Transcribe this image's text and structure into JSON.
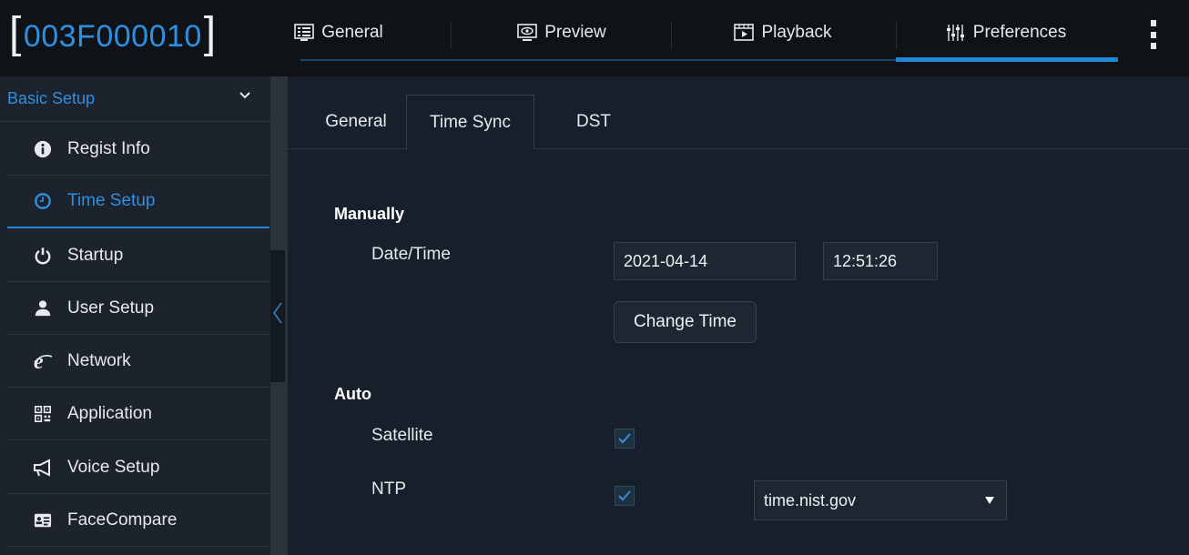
{
  "app": {
    "device_id": "003F000010",
    "accent": "#1e88d8"
  },
  "nav": {
    "tabs": [
      {
        "label": "General",
        "icon": "monitor-list-icon"
      },
      {
        "label": "Preview",
        "icon": "eye-monitor-icon"
      },
      {
        "label": "Playback",
        "icon": "playback-film-icon"
      },
      {
        "label": "Preferences",
        "icon": "sliders-icon",
        "active": true
      }
    ],
    "more_icon": "more-vertical-icon"
  },
  "sidebar": {
    "header": "Basic Setup",
    "items": [
      {
        "label": "Regist Info",
        "icon": "info-icon"
      },
      {
        "label": "Time Setup",
        "icon": "clock-icon",
        "active": true
      },
      {
        "label": "Startup",
        "icon": "power-icon"
      },
      {
        "label": "User Setup",
        "icon": "user-icon"
      },
      {
        "label": "Network",
        "icon": "internet-explorer-icon"
      },
      {
        "label": "Application",
        "icon": "qr-code-icon"
      },
      {
        "label": "Voice Setup",
        "icon": "megaphone-icon"
      },
      {
        "label": "FaceCompare",
        "icon": "id-card-icon"
      }
    ]
  },
  "subtabs": [
    {
      "label": "General"
    },
    {
      "label": "Time Sync",
      "active": true
    },
    {
      "label": "DST"
    }
  ],
  "manual": {
    "title": "Manually",
    "datetime_label": "Date/Time",
    "date_value": "2021-04-14",
    "time_value": "12:51:26",
    "change_button": "Change Time"
  },
  "auto": {
    "title": "Auto",
    "satellite_label": "Satellite",
    "satellite_checked": true,
    "ntp_label": "NTP",
    "ntp_checked": true,
    "ntp_server": "time.nist.gov"
  }
}
